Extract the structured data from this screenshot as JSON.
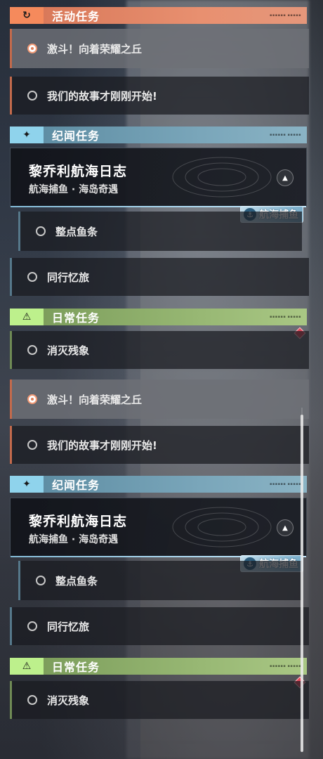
{
  "categories": {
    "activity": {
      "title": "活动任务",
      "icon": "cycle-icon",
      "color": "#f58a5c"
    },
    "story": {
      "title": "纪闻任务",
      "icon": "sparkle-icon",
      "color": "#8fd3ec"
    },
    "daily": {
      "title": "日常任务",
      "icon": "exclamation-icon",
      "color": "#bdf08c"
    }
  },
  "activity_quests": [
    {
      "label": "激斗！向着荣耀之丘",
      "selected": true
    },
    {
      "label": "我们的故事才刚刚开始!",
      "selected": false
    }
  ],
  "tracked_quest": {
    "title": "黎乔利航海日志",
    "subtitle": "航海捕鱼 · 海岛奇遇",
    "collapse_icon": "chevron-up-icon",
    "badge": "航海捕鱼"
  },
  "story_quests": [
    {
      "label": "整点鱼条"
    },
    {
      "label": "同行忆旅"
    }
  ],
  "daily_quests": [
    {
      "label": "消灭残象"
    }
  ],
  "accent_colors": {
    "activity": "#f58a5c",
    "story": "#8fd3ec",
    "daily": "#bdf08c",
    "alert": "#e3485a"
  }
}
